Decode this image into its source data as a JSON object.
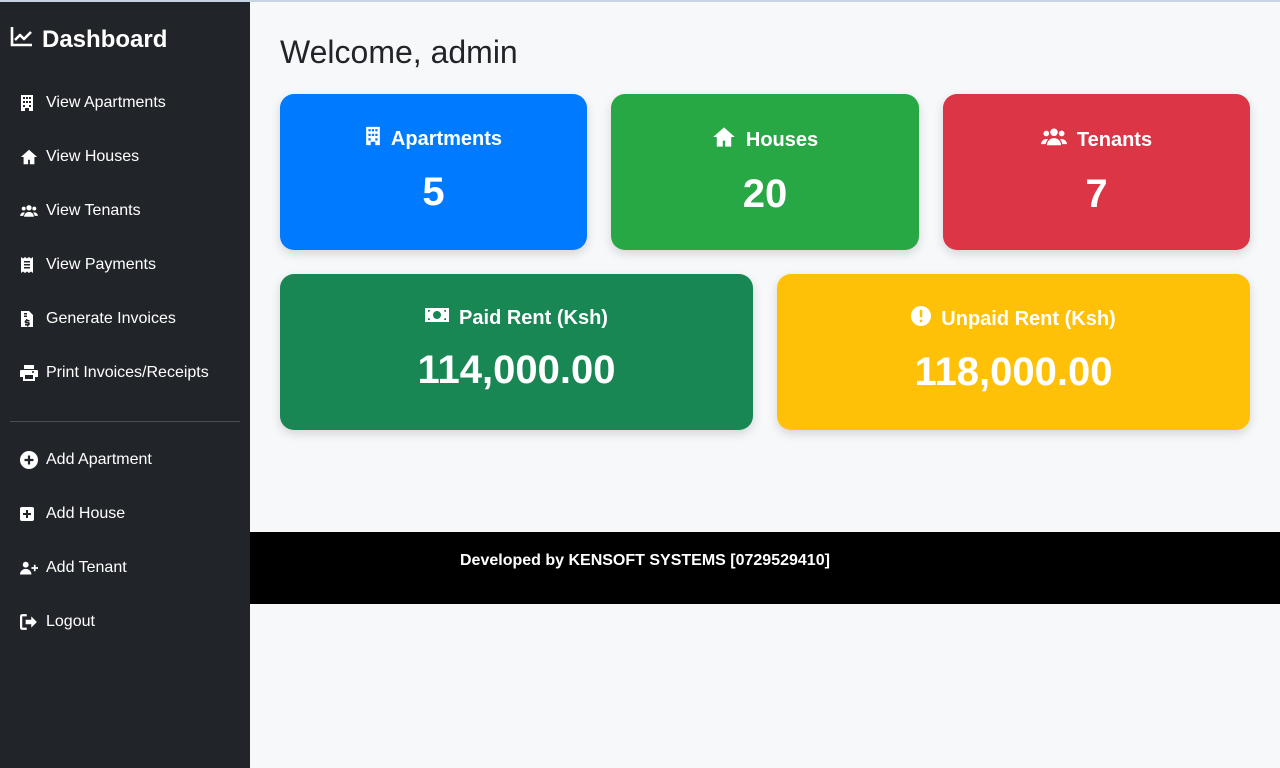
{
  "sidebar": {
    "brand": "Dashboard",
    "items": [
      {
        "label": "View Apartments",
        "icon": "building-icon"
      },
      {
        "label": "View Houses",
        "icon": "home-icon"
      },
      {
        "label": "View Tenants",
        "icon": "users-icon"
      },
      {
        "label": "View Payments",
        "icon": "receipt-icon"
      },
      {
        "label": "Generate Invoices",
        "icon": "invoice-icon"
      },
      {
        "label": "Print Invoices/Receipts",
        "icon": "print-icon"
      }
    ],
    "actions": [
      {
        "label": "Add Apartment",
        "icon": "plus-circle-icon"
      },
      {
        "label": "Add House",
        "icon": "plus-square-icon"
      },
      {
        "label": "Add Tenant",
        "icon": "user-plus-icon"
      },
      {
        "label": "Logout",
        "icon": "logout-icon"
      }
    ]
  },
  "main": {
    "welcome": "Welcome, admin",
    "cards": {
      "apartments": {
        "label": "Apartments",
        "value": "5",
        "color": "#007bff"
      },
      "houses": {
        "label": "Houses",
        "value": "20",
        "color": "#28a745"
      },
      "tenants": {
        "label": "Tenants",
        "value": "7",
        "color": "#dc3545"
      },
      "paid": {
        "label": "Paid Rent (Ksh)",
        "value": "114,000.00",
        "color": "#198754"
      },
      "unpaid": {
        "label": "Unpaid Rent (Ksh)",
        "value": "118,000.00",
        "color": "#ffc107"
      }
    }
  },
  "footer": {
    "text": "Developed by KENSOFT SYSTEMS [0729529410]"
  }
}
